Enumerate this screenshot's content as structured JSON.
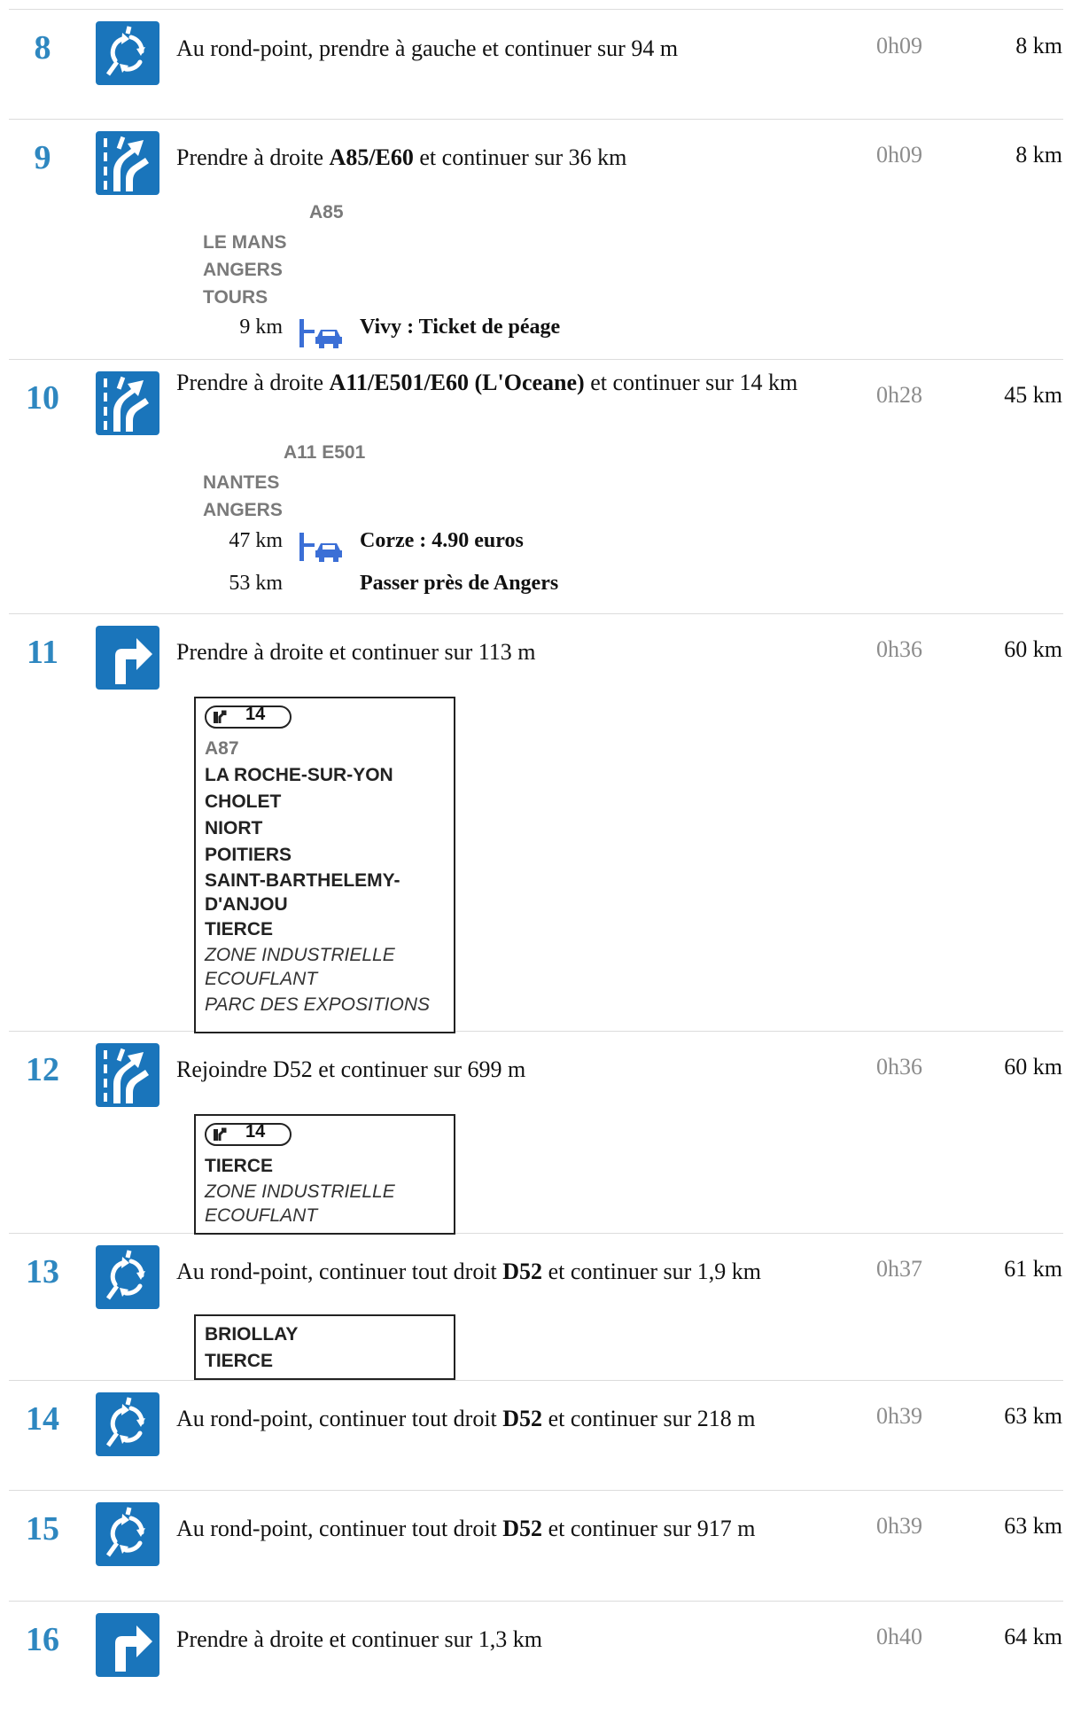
{
  "steps": [
    {
      "number": "8",
      "icon": "roundabout-icon",
      "parts": [
        {
          "t": "Au rond-point, prendre à gauche et continuer sur 94 m",
          "b": false
        }
      ],
      "time": "0h09",
      "distance": "8 km"
    },
    {
      "number": "9",
      "icon": "merge-right-icon",
      "parts": [
        {
          "t": "Prendre à droite ",
          "b": false
        },
        {
          "t": "A85/E60",
          "b": true
        },
        {
          "t": " et continuer sur 36 km",
          "b": false
        }
      ],
      "time": "0h09",
      "distance": "8 km",
      "signs": {
        "road": "A85",
        "destinations": [
          "LE MANS",
          "ANGERS",
          "TOURS"
        ]
      },
      "toll": {
        "km": "9 km",
        "text": "Vivy : Ticket de péage"
      }
    },
    {
      "number": "10",
      "icon": "merge-right-icon",
      "parts": [
        {
          "t": "Prendre à droite ",
          "b": false
        },
        {
          "t": "A11/E501/E60 (L'Oceane)",
          "b": true
        },
        {
          "t": " et continuer sur 14 km",
          "b": false
        }
      ],
      "time": "0h28",
      "distance": "45 km",
      "signs": {
        "road": "A11 E501",
        "destinations": [
          "NANTES",
          "ANGERS"
        ]
      },
      "toll": {
        "km": "47 km",
        "text": "Corze : 4.90 euros"
      },
      "pass": {
        "km": "53 km",
        "text": "Passer près de Angers"
      }
    },
    {
      "number": "11",
      "icon": "turn-right-icon",
      "parts": [
        {
          "t": "Prendre à droite et continuer sur 113 m",
          "b": false
        }
      ],
      "time": "0h36",
      "distance": "60 km",
      "panel": {
        "exit": "14",
        "road": "A87",
        "bold": [
          "LA ROCHE-SUR-YON",
          "CHOLET",
          "NIORT",
          "POITIERS",
          "SAINT-BARTHELEMY-D'ANJOU",
          "TIERCE"
        ],
        "italic": [
          "ZONE INDUSTRIELLE ECOUFLANT",
          "PARC DES EXPOSITIONS"
        ]
      }
    },
    {
      "number": "12",
      "icon": "merge-right-icon",
      "parts": [
        {
          "t": "Rejoindre D52 et continuer sur 699 m",
          "b": false
        }
      ],
      "time": "0h36",
      "distance": "60 km",
      "panel": {
        "exit": "14",
        "bold": [
          "TIERCE"
        ],
        "italic": [
          "ZONE INDUSTRIELLE ECOUFLANT"
        ]
      }
    },
    {
      "number": "13",
      "icon": "roundabout-icon",
      "parts": [
        {
          "t": "Au rond-point, continuer tout droit ",
          "b": false
        },
        {
          "t": "D52",
          "b": true
        },
        {
          "t": " et continuer sur 1,9 km",
          "b": false
        }
      ],
      "time": "0h37",
      "distance": "61 km",
      "panel": {
        "bold": [
          "BRIOLLAY",
          "TIERCE"
        ]
      }
    },
    {
      "number": "14",
      "icon": "roundabout-icon",
      "parts": [
        {
          "t": "Au rond-point, continuer tout droit ",
          "b": false
        },
        {
          "t": "D52",
          "b": true
        },
        {
          "t": " et continuer sur 218 m",
          "b": false
        }
      ],
      "time": "0h39",
      "distance": "63 km"
    },
    {
      "number": "15",
      "icon": "roundabout-icon",
      "parts": [
        {
          "t": "Au rond-point, continuer tout droit ",
          "b": false
        },
        {
          "t": "D52",
          "b": true
        },
        {
          "t": " et continuer sur 917 m",
          "b": false
        }
      ],
      "time": "0h39",
      "distance": "63 km"
    },
    {
      "number": "16",
      "icon": "turn-right-icon",
      "parts": [
        {
          "t": "Prendre à droite et continuer sur 1,3 km",
          "b": false
        }
      ],
      "time": "0h40",
      "distance": "64 km"
    }
  ],
  "colors": {
    "accent": "#2e87c0",
    "icon_bg": "#1a75bb",
    "toll_icon": "#3b6fd6",
    "time_grey": "#8c8c8c"
  }
}
